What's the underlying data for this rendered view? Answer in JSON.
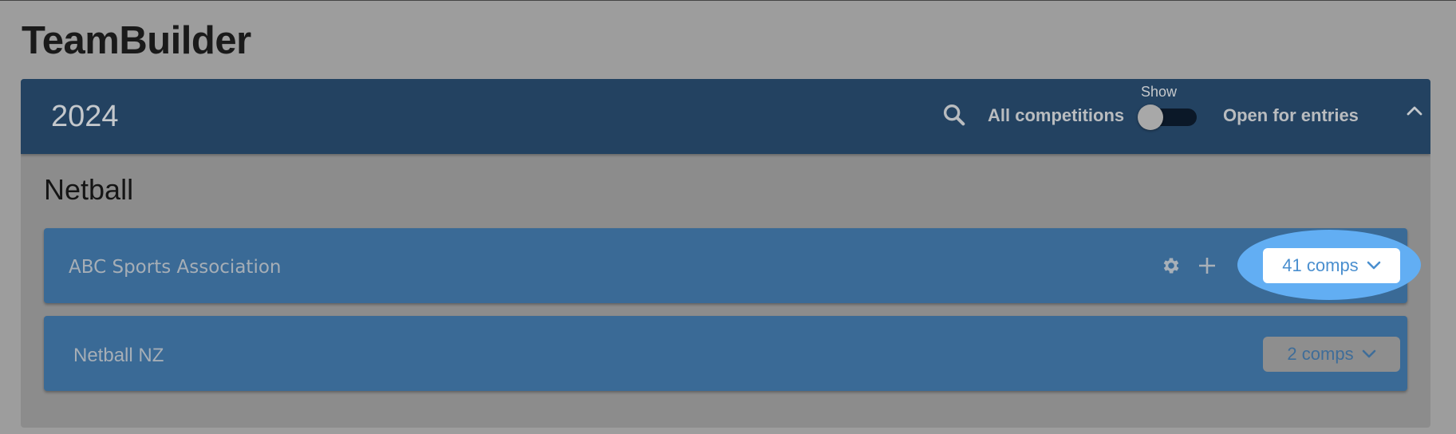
{
  "app": {
    "title": "TeamBuilder"
  },
  "header": {
    "year": "2024",
    "all_competitions": "All competitions",
    "show_label": "Show",
    "open_for_entries": "Open for entries",
    "toggle_on": false
  },
  "section": {
    "title": "Netball"
  },
  "orgs": [
    {
      "name": "ABC Sports Association",
      "comps_label": "41 comps"
    },
    {
      "name": "Netball NZ",
      "comps_label": "2 comps"
    }
  ],
  "colors": {
    "header_bg": "#234261",
    "row_bg": "#3a6a96",
    "highlight": "#62aef3",
    "toggle_track": "#0b1828"
  },
  "icons": [
    "search-icon",
    "gear-icon",
    "plus-icon",
    "chevron-down-icon",
    "chevron-up-icon"
  ]
}
